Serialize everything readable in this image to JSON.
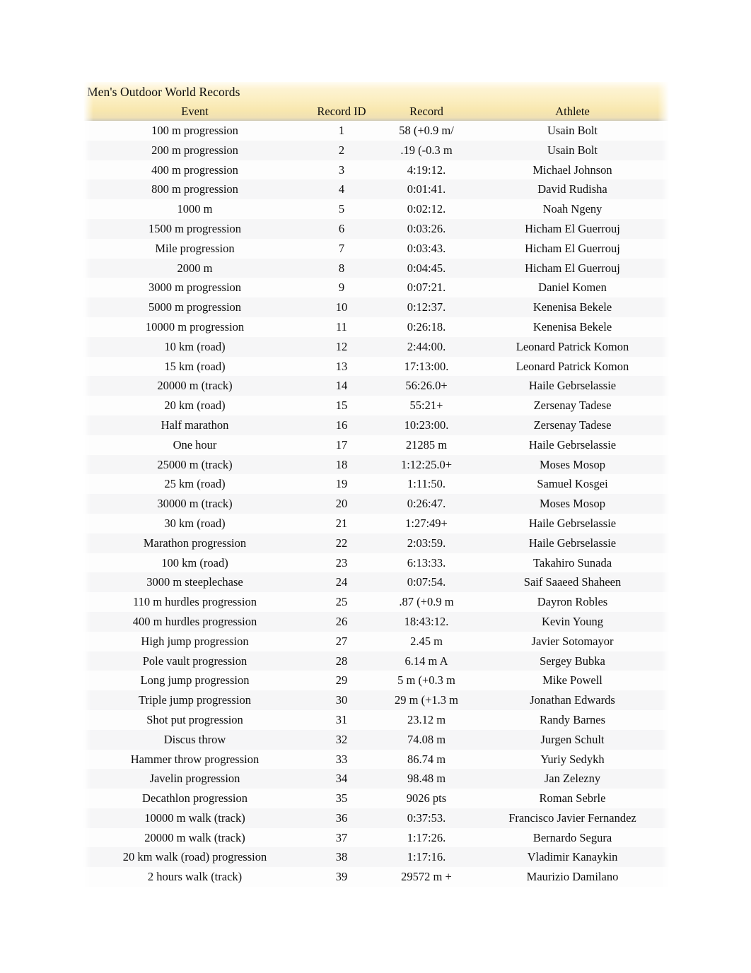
{
  "report": {
    "title": "Men's Outdoor World Records",
    "theme": {
      "header_background_top": "#fffdf3",
      "header_background_mid": "#fbeec0",
      "header_background_bottom": "#f8e7ae",
      "header_shadow": "#787468",
      "row_band_light": "#fdfdfd",
      "row_band_dark": "#f6f6f7",
      "text_color": "#0d0d0d"
    }
  },
  "table": {
    "columns": [
      {
        "key": "event",
        "label": "Event"
      },
      {
        "key": "record_id",
        "label": "Record ID"
      },
      {
        "key": "record",
        "label": "Record"
      },
      {
        "key": "athlete",
        "label": "Athlete"
      }
    ],
    "rows": [
      {
        "event": "100 m progression",
        "record_id": "1",
        "record": "58 (+0.9 m/",
        "athlete": "Usain Bolt"
      },
      {
        "event": "200 m progression",
        "record_id": "2",
        "record": ".19 (-0.3 m",
        "athlete": "Usain Bolt"
      },
      {
        "event": "400 m progression",
        "record_id": "3",
        "record": "4:19:12.",
        "athlete": "Michael Johnson"
      },
      {
        "event": "800 m progression",
        "record_id": "4",
        "record": "0:01:41.",
        "athlete": "David Rudisha"
      },
      {
        "event": "1000 m",
        "record_id": "5",
        "record": "0:02:12.",
        "athlete": "Noah Ngeny"
      },
      {
        "event": "1500 m progression",
        "record_id": "6",
        "record": "0:03:26.",
        "athlete": "Hicham El Guerrouj"
      },
      {
        "event": "Mile progression",
        "record_id": "7",
        "record": "0:03:43.",
        "athlete": "Hicham El Guerrouj"
      },
      {
        "event": "2000 m",
        "record_id": "8",
        "record": "0:04:45.",
        "athlete": "Hicham El Guerrouj"
      },
      {
        "event": "3000 m progression",
        "record_id": "9",
        "record": "0:07:21.",
        "athlete": "Daniel Komen"
      },
      {
        "event": "5000 m progression",
        "record_id": "10",
        "record": "0:12:37.",
        "athlete": "Kenenisa Bekele"
      },
      {
        "event": "10000 m progression",
        "record_id": "11",
        "record": "0:26:18.",
        "athlete": "Kenenisa Bekele"
      },
      {
        "event": "10 km (road)",
        "record_id": "12",
        "record": "2:44:00.",
        "athlete": "Leonard Patrick Komon"
      },
      {
        "event": "15 km (road)",
        "record_id": "13",
        "record": "17:13:00.",
        "athlete": "Leonard Patrick Komon"
      },
      {
        "event": "20000 m (track)",
        "record_id": "14",
        "record": "56:26.0+",
        "athlete": "Haile Gebrselassie"
      },
      {
        "event": "20 km (road)",
        "record_id": "15",
        "record": "55:21+",
        "athlete": "Zersenay Tadese"
      },
      {
        "event": "Half marathon",
        "record_id": "16",
        "record": "10:23:00.",
        "athlete": "Zersenay Tadese"
      },
      {
        "event": "One hour",
        "record_id": "17",
        "record": "21285 m",
        "athlete": "Haile Gebrselassie"
      },
      {
        "event": "25000 m (track)",
        "record_id": "18",
        "record": "1:12:25.0+",
        "athlete": "Moses Mosop"
      },
      {
        "event": "25 km (road)",
        "record_id": "19",
        "record": "1:11:50.",
        "athlete": "Samuel Kosgei"
      },
      {
        "event": "30000 m (track)",
        "record_id": "20",
        "record": "0:26:47.",
        "athlete": "Moses Mosop"
      },
      {
        "event": "30 km (road)",
        "record_id": "21",
        "record": "1:27:49+",
        "athlete": "Haile Gebrselassie"
      },
      {
        "event": "Marathon progression",
        "record_id": "22",
        "record": "2:03:59.",
        "athlete": "Haile Gebrselassie"
      },
      {
        "event": "100 km (road)",
        "record_id": "23",
        "record": "6:13:33.",
        "athlete": "Takahiro Sunada"
      },
      {
        "event": "3000 m steeplechase",
        "record_id": "24",
        "record": "0:07:54.",
        "athlete": "Saif Saaeed Shaheen"
      },
      {
        "event": "110 m hurdles progression",
        "record_id": "25",
        "record": ".87 (+0.9 m",
        "athlete": "Dayron Robles"
      },
      {
        "event": "400 m hurdles progression",
        "record_id": "26",
        "record": "18:43:12.",
        "athlete": "Kevin Young"
      },
      {
        "event": "High jump progression",
        "record_id": "27",
        "record": "2.45 m",
        "athlete": "Javier Sotomayor"
      },
      {
        "event": "Pole vault progression",
        "record_id": "28",
        "record": "6.14 m A",
        "athlete": "Sergey Bubka"
      },
      {
        "event": "Long jump progression",
        "record_id": "29",
        "record": "5 m (+0.3 m",
        "athlete": "Mike Powell"
      },
      {
        "event": "Triple jump progression",
        "record_id": "30",
        "record": "29 m (+1.3 m",
        "athlete": "Jonathan Edwards"
      },
      {
        "event": "Shot put progression",
        "record_id": "31",
        "record": "23.12 m",
        "athlete": "Randy Barnes"
      },
      {
        "event": "Discus throw",
        "record_id": "32",
        "record": "74.08 m",
        "athlete": "Jurgen Schult"
      },
      {
        "event": "Hammer throw progression",
        "record_id": "33",
        "record": "86.74 m",
        "athlete": "Yuriy Sedykh"
      },
      {
        "event": "Javelin progression",
        "record_id": "34",
        "record": "98.48 m",
        "athlete": "Jan Zelezny"
      },
      {
        "event": "Decathlon progression",
        "record_id": "35",
        "record": "9026 pts",
        "athlete": "Roman Sebrle"
      },
      {
        "event": "10000 m walk (track)",
        "record_id": "36",
        "record": "0:37:53.",
        "athlete": "Francisco Javier Fernandez"
      },
      {
        "event": "20000 m walk (track)",
        "record_id": "37",
        "record": "1:17:26.",
        "athlete": "Bernardo Segura"
      },
      {
        "event": "20 km walk (road) progression",
        "record_id": "38",
        "record": "1:17:16.",
        "athlete": "Vladimir Kanaykin"
      },
      {
        "event": "2 hours walk (track)",
        "record_id": "39",
        "record": "29572 m +",
        "athlete": "Maurizio Damilano"
      }
    ]
  }
}
